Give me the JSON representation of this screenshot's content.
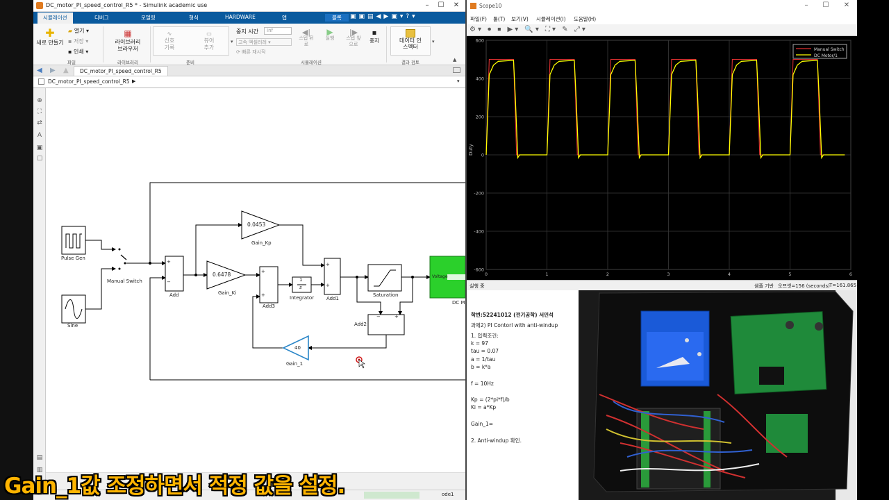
{
  "simulink": {
    "title": "DC_motor_PI_speed_control_R5 * - Simulink academic use",
    "tabs": [
      "시뮬레이션",
      "디버그",
      "모델링",
      "형식",
      "HARDWARE",
      "앱",
      "블록"
    ],
    "ribbon": {
      "new": "새로 만들기",
      "open": "열기",
      "save": "저장",
      "print": "인쇄",
      "file_group": "파일",
      "library": "라이브러리 브라우저",
      "library_group": "라이브러리",
      "signal_log": "신호 기록",
      "add_viewer": "뷰어 추가",
      "prepare_group": "준비",
      "stop_time_label": "중지 시간",
      "stop_time_value": "Inf",
      "accel_mode": "고속 엑셀러레",
      "fast_restart": "빠른 재시작",
      "step_back": "스텝 뒤로",
      "run": "실행",
      "step_fwd": "스텝 앞으로",
      "stop": "중지",
      "sim_group": "시뮬레이션",
      "data_inspector": "데이터 인스펙터",
      "review_group": "결과 검토"
    },
    "tab_model": "DC_motor_PI_speed_control_R5",
    "breadcrumb": "DC_motor_PI_speed_control_R5",
    "status": {
      "solver": "ode1"
    },
    "blocks": {
      "pulse_gen": "Pulse Gen",
      "sine": "Sine",
      "manual_switch": "Manual Switch",
      "add": "Add",
      "gain_kp": "Gain_Kp",
      "gain_kp_value": "0.0453",
      "gain_ki": "Gain_Ki",
      "gain_ki_value": "0.6478",
      "add3": "Add3",
      "integrator": "Integrator",
      "integrator_num": "1",
      "integrator_den": "s",
      "add1": "Add1",
      "saturation": "Saturation",
      "add2": "Add2",
      "gain_1": "Gain_1",
      "gain_1_value": "40",
      "voltage_port": "Voltage",
      "dc_block": "DC M",
      "plus": "+",
      "minus": "−"
    }
  },
  "scope": {
    "title": "Scope10",
    "menu": [
      "파일(F)",
      "툴(T)",
      "보기(V)",
      "시뮬레이션(I)",
      "도움말(H)"
    ],
    "status_left": "실행 중",
    "status_mid": "샘플 기반",
    "status_offset": "오프셋=156 (seconds)",
    "status_time": "T=161.865",
    "accent": "#ffff00"
  },
  "chart_data": {
    "type": "line",
    "title": "",
    "xlabel": "",
    "ylabel": "Duty",
    "xlim": [
      0,
      6
    ],
    "ylim": [
      -600,
      600
    ],
    "x_ticks": [
      "0",
      "1",
      "2",
      "3",
      "4",
      "5",
      "6"
    ],
    "y_ticks": [
      "600",
      "400",
      "200",
      "0",
      "-200",
      "-400",
      "-600"
    ],
    "grid": true,
    "legend_position": "top-right",
    "series": [
      {
        "name": "Manual Switch",
        "color": "#e03030",
        "x": [
          0,
          0.05,
          0.45,
          0.5,
          1.0,
          1.05,
          1.45,
          1.5,
          2.0,
          2.05,
          2.45,
          2.5,
          3.0,
          3.05,
          3.45,
          3.5,
          4.0,
          4.05,
          4.45,
          4.5,
          5.0,
          5.05,
          5.45,
          5.5,
          5.9
        ],
        "y": [
          0,
          500,
          500,
          0,
          0,
          500,
          500,
          0,
          0,
          500,
          500,
          0,
          0,
          500,
          500,
          0,
          0,
          500,
          500,
          0,
          0,
          500,
          500,
          0,
          0
        ]
      },
      {
        "name": "DC Motor/1",
        "color": "#ffff00",
        "x": [
          0,
          0.05,
          0.12,
          0.2,
          0.45,
          0.48,
          0.52,
          0.55,
          1.0,
          1.05,
          1.12,
          1.2,
          1.45,
          1.48,
          1.52,
          1.55,
          2.0,
          2.05,
          2.12,
          2.2,
          2.45,
          2.48,
          2.52,
          2.55,
          3.0,
          3.05,
          3.12,
          3.2,
          3.45,
          3.48,
          3.52,
          3.55,
          4.0,
          4.05,
          4.12,
          4.2,
          4.45,
          4.48,
          4.52,
          4.55,
          5.0,
          5.05,
          5.12,
          5.2,
          5.45,
          5.48,
          5.52,
          5.55,
          5.9
        ],
        "y": [
          0,
          420,
          470,
          490,
          495,
          300,
          -15,
          0,
          0,
          420,
          470,
          490,
          495,
          300,
          -15,
          0,
          0,
          420,
          470,
          490,
          495,
          300,
          -15,
          0,
          0,
          420,
          470,
          490,
          495,
          300,
          -15,
          0,
          0,
          420,
          470,
          490,
          495,
          300,
          -15,
          0,
          0,
          420,
          470,
          490,
          495,
          300,
          -15,
          0,
          0
        ]
      }
    ]
  },
  "notes": {
    "student": "학번:52241012 (전기공학) 서민석",
    "task": "과제2) PI Contorl with anti-windup",
    "lines": [
      "1. 입력조건:",
      "k = 97",
      "tau = 0.07",
      "a = 1/tau",
      "b = k*a",
      "",
      "f = 10Hz",
      "",
      "Kp = (2*pi*f)/b",
      "Ki = a*Kp",
      "",
      "Gain_1=",
      "",
      "2. Anti-windup 확인."
    ]
  },
  "caption": "Gain_1값 조정하면서 적정 값을 설정."
}
